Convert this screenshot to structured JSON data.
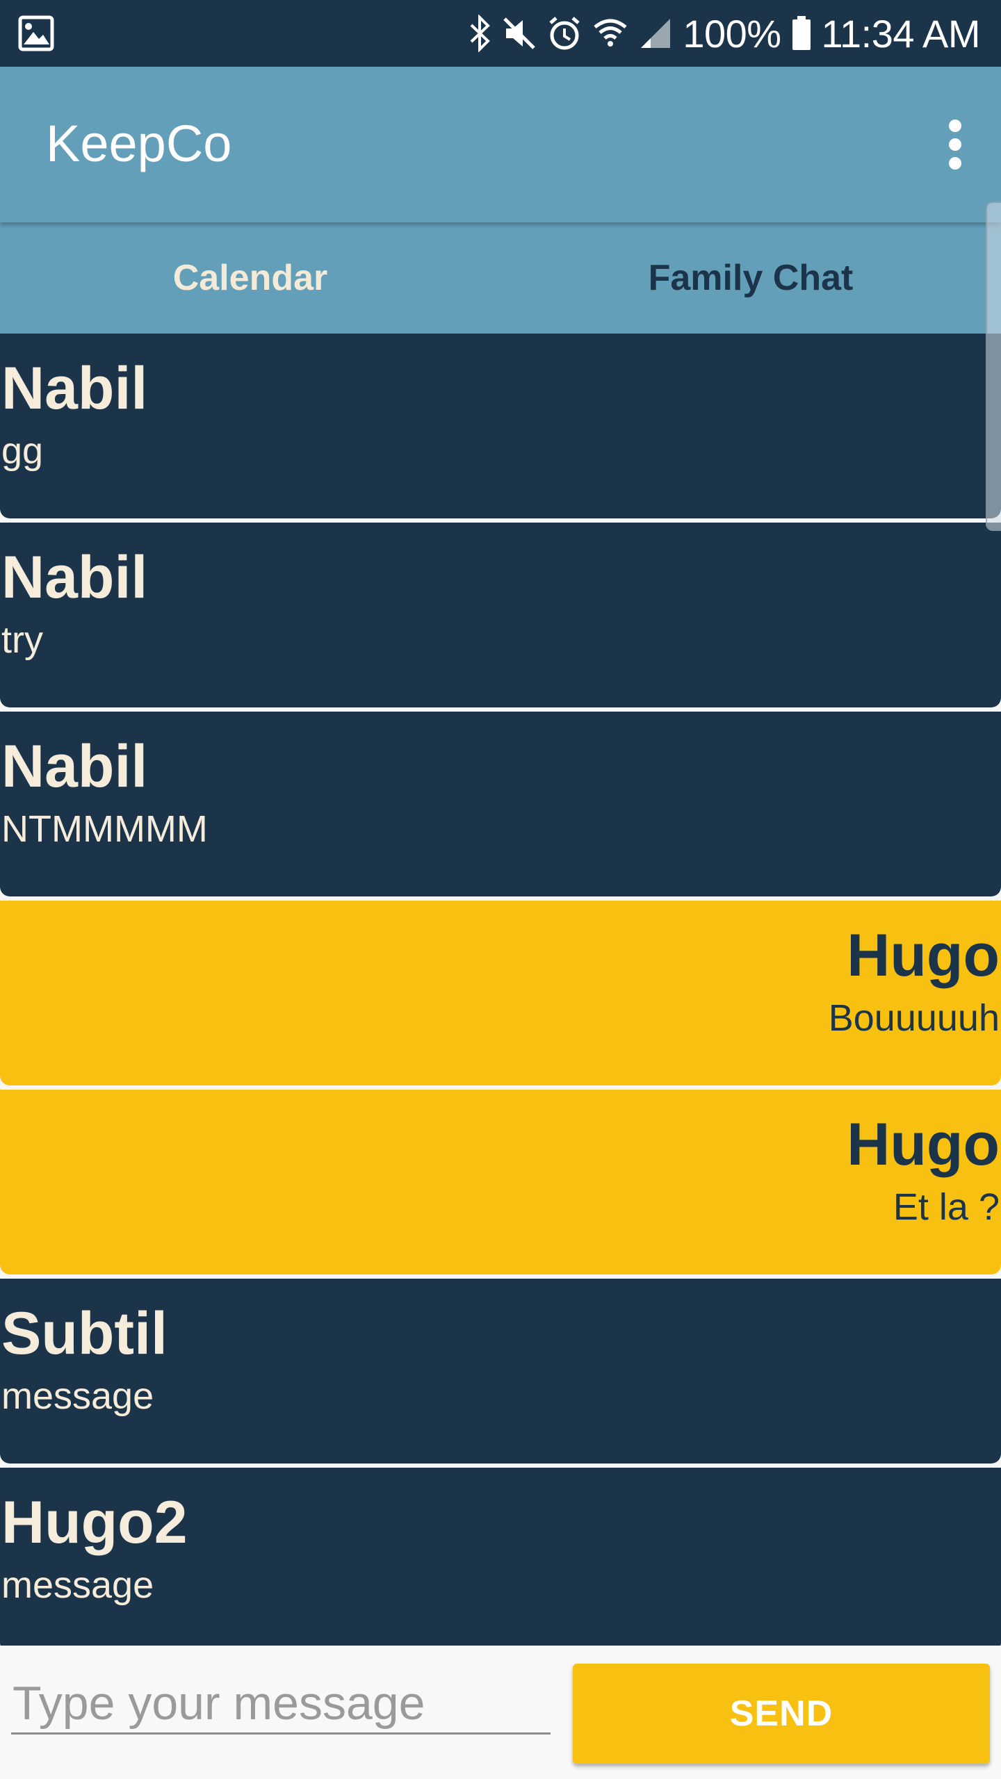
{
  "status_bar": {
    "battery": "100%",
    "time": "11:34 AM",
    "icons": [
      "image-notification-icon",
      "bluetooth-icon",
      "mute-icon",
      "alarm-icon",
      "wifi-icon",
      "cell-signal-icon",
      "battery-icon"
    ]
  },
  "app_bar": {
    "title": "KeepCo",
    "menu_icon": "more-vert-icon",
    "background": "#649fba"
  },
  "tabs": [
    {
      "label": "Calendar",
      "selected": false
    },
    {
      "label": "Family Chat",
      "selected": true
    }
  ],
  "messages": [
    {
      "name": "Nabil",
      "text": "gg",
      "side": "left"
    },
    {
      "name": "Nabil",
      "text": "try",
      "side": "left"
    },
    {
      "name": "Nabil",
      "text": "NTMMMMM",
      "side": "left"
    },
    {
      "name": "Hugo",
      "text": "Bouuuuuh",
      "side": "right"
    },
    {
      "name": "Hugo",
      "text": "Et la ?",
      "side": "right"
    },
    {
      "name": "Subtil",
      "text": "message",
      "side": "left"
    },
    {
      "name": "Hugo2",
      "text": "message",
      "side": "left"
    }
  ],
  "composer": {
    "placeholder": "Type your message",
    "value": "",
    "send_label": "SEND"
  },
  "colors": {
    "dark": "#1c3449",
    "accent": "#f8c011",
    "cream": "#f6ecdc"
  }
}
